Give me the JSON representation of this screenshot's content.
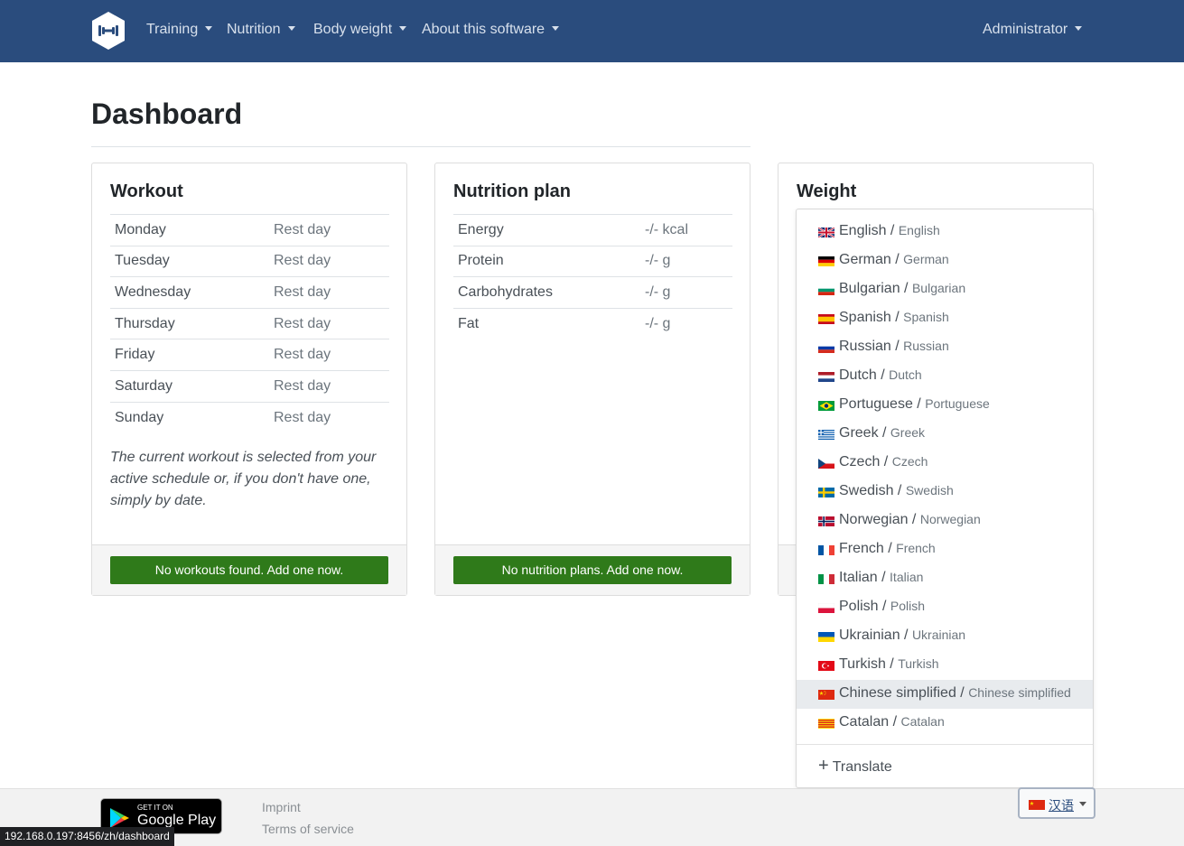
{
  "navbar": {
    "items": [
      {
        "label": "Training"
      },
      {
        "label": "Nutrition"
      },
      {
        "label": "Body weight"
      },
      {
        "label": "About this software"
      }
    ],
    "user": "Administrator",
    "bg_color": "#2a4c7d"
  },
  "page": {
    "title": "Dashboard"
  },
  "workout": {
    "title": "Workout",
    "rows": [
      {
        "day": "Monday",
        "value": "Rest day"
      },
      {
        "day": "Tuesday",
        "value": "Rest day"
      },
      {
        "day": "Wednesday",
        "value": "Rest day"
      },
      {
        "day": "Thursday",
        "value": "Rest day"
      },
      {
        "day": "Friday",
        "value": "Rest day"
      },
      {
        "day": "Saturday",
        "value": "Rest day"
      },
      {
        "day": "Sunday",
        "value": "Rest day"
      }
    ],
    "note": "The current workout is selected from your active schedule or, if you don't have one, simply by date.",
    "button": "No workouts found. Add one now."
  },
  "nutrition": {
    "title": "Nutrition plan",
    "rows": [
      {
        "name": "Energy",
        "value": "-/- kcal"
      },
      {
        "name": "Protein",
        "value": "-/- g"
      },
      {
        "name": "Carbohydrates",
        "value": "-/- g"
      },
      {
        "name": "Fat",
        "value": "-/- g"
      }
    ],
    "button": "No nutrition plans. Add one now."
  },
  "weight": {
    "title": "Weight"
  },
  "language_menu": {
    "items": [
      {
        "name": "English",
        "native": "English",
        "flag": "gb-flag-icon"
      },
      {
        "name": "German",
        "native": "German",
        "flag": "de-flag-icon"
      },
      {
        "name": "Bulgarian",
        "native": "Bulgarian",
        "flag": "bg-flag-icon"
      },
      {
        "name": "Spanish",
        "native": "Spanish",
        "flag": "es-flag-icon"
      },
      {
        "name": "Russian",
        "native": "Russian",
        "flag": "ru-flag-icon"
      },
      {
        "name": "Dutch",
        "native": "Dutch",
        "flag": "nl-flag-icon"
      },
      {
        "name": "Portuguese",
        "native": "Portuguese",
        "flag": "br-flag-icon"
      },
      {
        "name": "Greek",
        "native": "Greek",
        "flag": "gr-flag-icon"
      },
      {
        "name": "Czech",
        "native": "Czech",
        "flag": "cz-flag-icon"
      },
      {
        "name": "Swedish",
        "native": "Swedish",
        "flag": "se-flag-icon"
      },
      {
        "name": "Norwegian",
        "native": "Norwegian",
        "flag": "no-flag-icon"
      },
      {
        "name": "French",
        "native": "French",
        "flag": "fr-flag-icon"
      },
      {
        "name": "Italian",
        "native": "Italian",
        "flag": "it-flag-icon"
      },
      {
        "name": "Polish",
        "native": "Polish",
        "flag": "pl-flag-icon"
      },
      {
        "name": "Ukrainian",
        "native": "Ukrainian",
        "flag": "ua-flag-icon"
      },
      {
        "name": "Turkish",
        "native": "Turkish",
        "flag": "tr-flag-icon"
      },
      {
        "name": "Chinese simplified",
        "native": "Chinese simplified",
        "flag": "cn-flag-icon"
      },
      {
        "name": "Catalan",
        "native": "Catalan",
        "flag": "ca-flag-icon"
      }
    ],
    "active": "Chinese simplified",
    "translate_label": "Translate"
  },
  "footer": {
    "store_small": "GET IT ON",
    "store_big": "Google Play",
    "links": [
      "Imprint",
      "Terms of service"
    ],
    "language_button": "汉语",
    "status_url": "192.168.0.197:8456/zh/dashboard"
  },
  "colors": {
    "accent": "#2a4c7d",
    "button_green": "#2f7a1a"
  }
}
